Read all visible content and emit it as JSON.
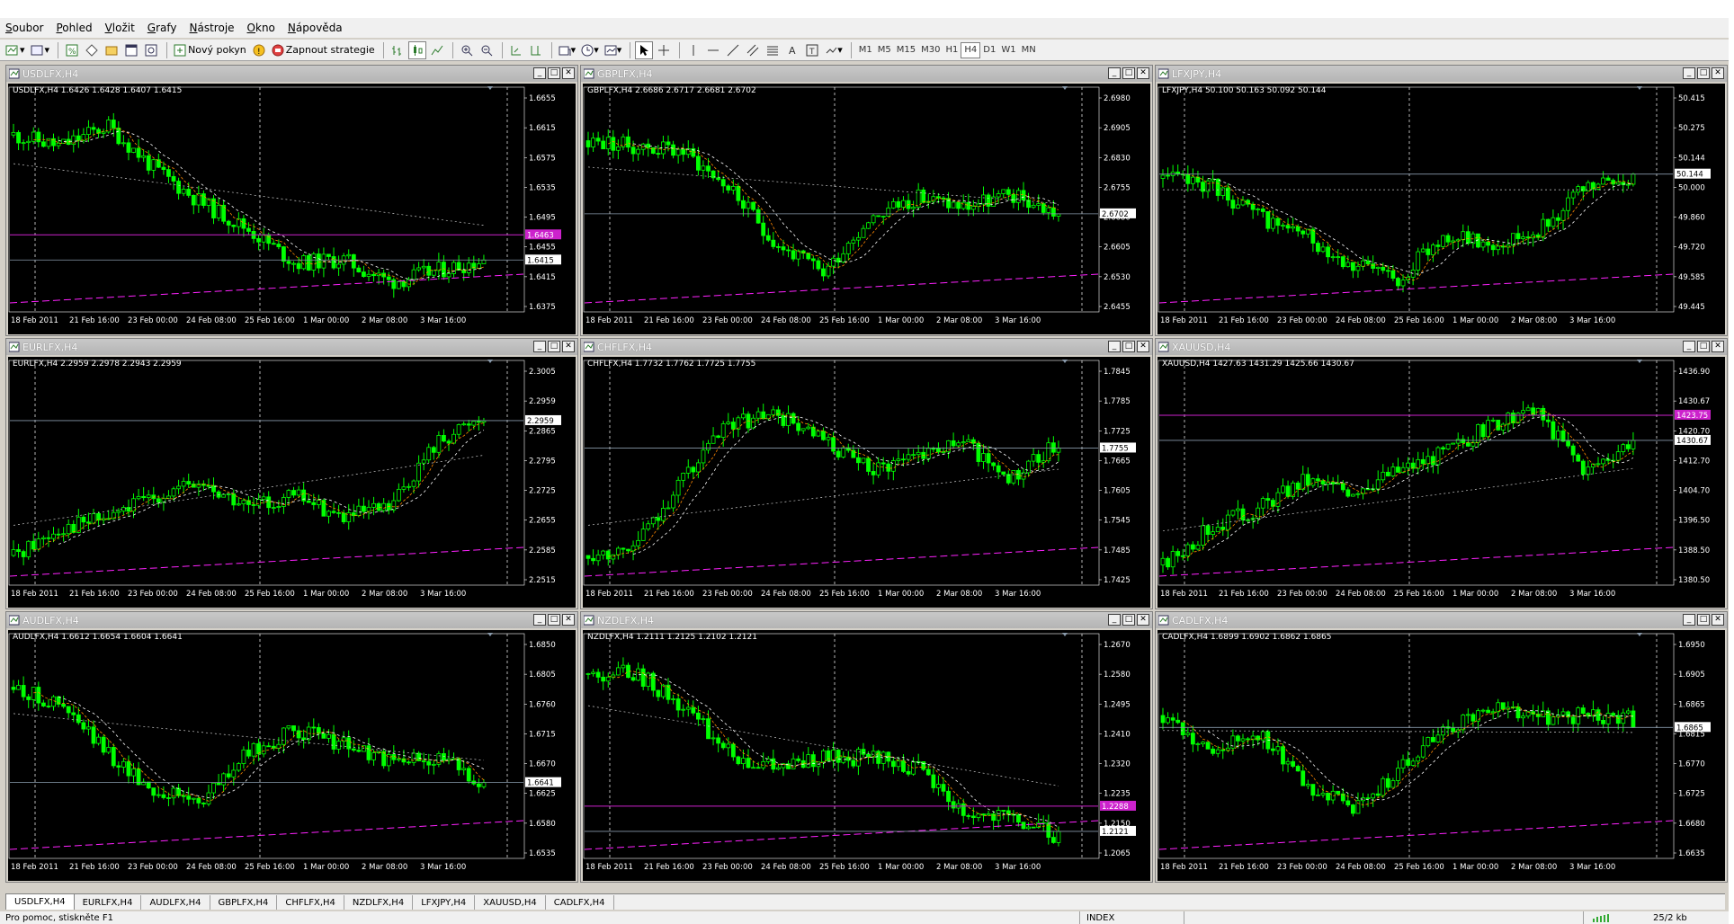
{
  "menu": [
    "Soubor",
    "Pohled",
    "Vložit",
    "Grafy",
    "Nástroje",
    "Okno",
    "Nápověda"
  ],
  "toolbar": {
    "new_order_label": "Nový pokyn",
    "strategy_label": "Zapnout strategie",
    "timeframes": [
      "M1",
      "M5",
      "M15",
      "M30",
      "H1",
      "H4",
      "D1",
      "W1",
      "MN"
    ],
    "active_timeframe": "H4"
  },
  "charts": [
    {
      "title": "USDLFX,H4",
      "ohlc": "USDLFX,H4  1.6426 1.6428 1.6407 1.6415",
      "prices": [
        "1.6655",
        "1.6615",
        "1.6575",
        "1.6535",
        "1.6495",
        "1.6455",
        "1.6415",
        "1.6375"
      ],
      "x_labels": [
        "18 Feb 2011",
        "21 Feb 16:00",
        "23 Feb 00:00",
        "24 Feb 08:00",
        "25 Feb 16:00",
        "1 Mar 00:00",
        "2 Mar 08:00",
        "3 Mar 16:00"
      ],
      "current_price": "1.6415",
      "marked_price": "1.6463",
      "marked_color": "#cc22cc",
      "seed": 11,
      "path": [
        0.88,
        0.82,
        0.93,
        0.7,
        0.52,
        0.38,
        0.2,
        0.22,
        0.1,
        0.16,
        0.22
      ]
    },
    {
      "title": "GBPLFX,H4",
      "ohlc": "GBPLFX,H4  2.6686 2.6717 2.6681 2.6702",
      "prices": [
        "2.6980",
        "2.6905",
        "2.6830",
        "2.6755",
        "2.6680",
        "2.6605",
        "2.6530",
        "2.6455"
      ],
      "x_labels": [
        "18 Feb 2011",
        "21 Feb 16:00",
        "23 Feb 00:00",
        "24 Feb 08:00",
        "25 Feb 16:00",
        "1 Mar 00:00",
        "2 Mar 08:00",
        "3 Mar 16:00"
      ],
      "current_price": "2.6702",
      "marked_price": "",
      "marked_color": "",
      "seed": 23,
      "path": [
        0.85,
        0.82,
        0.8,
        0.6,
        0.3,
        0.15,
        0.45,
        0.55,
        0.5,
        0.56,
        0.46
      ]
    },
    {
      "title": "LFXJPY,H4",
      "ohlc": "LFXJPY,H4  50.100 50.163 50.092 50.144",
      "prices": [
        "50.415",
        "50.275",
        "50.144",
        "50.000",
        "49.860",
        "49.720",
        "49.585",
        "49.445"
      ],
      "x_labels": [
        "18 Feb 2011",
        "21 Feb 16:00",
        "23 Feb 00:00",
        "24 Feb 08:00",
        "25 Feb 16:00",
        "1 Mar 00:00",
        "2 Mar 08:00",
        "3 Mar 16:00"
      ],
      "current_price": "50.144",
      "marked_price": "",
      "marked_color": "",
      "seed": 37,
      "path": [
        0.65,
        0.62,
        0.45,
        0.35,
        0.2,
        0.12,
        0.35,
        0.3,
        0.38,
        0.6,
        0.65
      ]
    },
    {
      "title": "EURLFX,H4",
      "ohlc": "EURLFX,H4  2.2959 2.2978 2.2943 2.2959",
      "prices": [
        "2.3005",
        "2.2959",
        "2.2865",
        "2.2795",
        "2.2725",
        "2.2655",
        "2.2585",
        "2.2515"
      ],
      "x_labels": [
        "18 Feb 2011",
        "21 Feb 16:00",
        "23 Feb 00:00",
        "24 Feb 08:00",
        "25 Feb 16:00",
        "1 Mar 00:00",
        "2 Mar 08:00",
        "3 Mar 16:00"
      ],
      "current_price": "2.2959",
      "marked_price": "",
      "marked_color": "",
      "seed": 41,
      "path": [
        0.1,
        0.25,
        0.3,
        0.42,
        0.48,
        0.35,
        0.42,
        0.3,
        0.35,
        0.7,
        0.85
      ]
    },
    {
      "title": "CHFLFX,H4",
      "ohlc": "CHFLFX,H4  1.7732 1.7762 1.7725 1.7755",
      "prices": [
        "1.7845",
        "1.7785",
        "1.7725",
        "1.7665",
        "1.7605",
        "1.7545",
        "1.7485",
        "1.7425"
      ],
      "x_labels": [
        "18 Feb 2011",
        "21 Feb 16:00",
        "23 Feb 00:00",
        "24 Feb 08:00",
        "25 Feb 16:00",
        "1 Mar 00:00",
        "2 Mar 08:00",
        "3 Mar 16:00"
      ],
      "current_price": "1.7755",
      "marked_price": "",
      "marked_color": "",
      "seed": 53,
      "path": [
        0.1,
        0.15,
        0.5,
        0.8,
        0.85,
        0.7,
        0.55,
        0.65,
        0.7,
        0.5,
        0.7
      ]
    },
    {
      "title": "XAUUSD,H4",
      "ohlc": "XAUUSD,H4  1427.63 1431.29 1425.66 1430.67",
      "prices": [
        "1436.90",
        "1430.67",
        "1420.70",
        "1412.70",
        "1404.70",
        "1396.50",
        "1388.50",
        "1380.50"
      ],
      "x_labels": [
        "18 Feb 2011",
        "21 Feb 16:00",
        "23 Feb 00:00",
        "24 Feb 08:00",
        "25 Feb 16:00",
        "1 Mar 00:00",
        "2 Mar 08:00",
        "3 Mar 16:00"
      ],
      "current_price": "1430.67",
      "marked_price": "1423.75",
      "marked_color": "#cc22cc",
      "seed": 67,
      "path": [
        0.05,
        0.25,
        0.35,
        0.5,
        0.45,
        0.55,
        0.65,
        0.8,
        0.85,
        0.55,
        0.72
      ]
    },
    {
      "title": "AUDLFX,H4",
      "ohlc": "AUDLFX,H4  1.6612 1.6654 1.6604 1.6641",
      "prices": [
        "1.6850",
        "1.6805",
        "1.6760",
        "1.6715",
        "1.6670",
        "1.6625",
        "1.6580",
        "1.6535"
      ],
      "x_labels": [
        "18 Feb 2011",
        "21 Feb 16:00",
        "23 Feb 00:00",
        "24 Feb 08:00",
        "25 Feb 16:00",
        "1 Mar 00:00",
        "2 Mar 08:00",
        "3 Mar 16:00"
      ],
      "current_price": "1.6641",
      "marked_price": "",
      "marked_color": "",
      "seed": 79,
      "path": [
        0.85,
        0.75,
        0.5,
        0.3,
        0.25,
        0.5,
        0.62,
        0.55,
        0.45,
        0.48,
        0.35
      ]
    },
    {
      "title": "NZDLFX,H4",
      "ohlc": "NZDLFX,H4  1.2111 1.2125 1.2102 1.2121",
      "prices": [
        "1.2670",
        "1.2580",
        "1.2495",
        "1.2410",
        "1.2320",
        "1.2235",
        "1.2150",
        "1.2065"
      ],
      "x_labels": [
        "18 Feb 2011",
        "21 Feb 16:00",
        "23 Feb 00:00",
        "24 Feb 08:00",
        "25 Feb 16:00",
        "1 Mar 00:00",
        "2 Mar 08:00",
        "3 Mar 16:00"
      ],
      "current_price": "1.2121",
      "marked_price": "1.2288",
      "marked_color": "#cc22cc",
      "seed": 83,
      "path": [
        0.92,
        0.93,
        0.75,
        0.5,
        0.42,
        0.47,
        0.48,
        0.42,
        0.18,
        0.15,
        0.06
      ]
    },
    {
      "title": "CADLFX,H4",
      "ohlc": "CADLFX,H4  1.6899 1.6902 1.6862 1.6865",
      "prices": [
        "1.6950",
        "1.6905",
        "1.6865",
        "1.6815",
        "1.6770",
        "1.6725",
        "1.6680",
        "1.6635"
      ],
      "x_labels": [
        "18 Feb 2011",
        "21 Feb 16:00",
        "23 Feb 00:00",
        "24 Feb 08:00",
        "25 Feb 16:00",
        "1 Mar 00:00",
        "2 Mar 08:00",
        "3 Mar 16:00"
      ],
      "current_price": "1.6865",
      "marked_price": "",
      "marked_color": "",
      "seed": 97,
      "path": [
        0.7,
        0.5,
        0.62,
        0.35,
        0.2,
        0.4,
        0.62,
        0.75,
        0.68,
        0.7,
        0.68
      ]
    }
  ],
  "tabs": [
    "USDLFX,H4",
    "EURLFX,H4",
    "AUDLFX,H4",
    "GBPLFX,H4",
    "CHFLFX,H4",
    "NZDLFX,H4",
    "LFXJPY,H4",
    "XAUUSD,H4",
    "CADLFX,H4"
  ],
  "active_tab": "USDLFX,H4",
  "status": {
    "help": "Pro pomoc, stiskněte F1",
    "profile": "INDEX",
    "traffic": "25/2 kb"
  },
  "colors": {
    "bull": "#00ff00",
    "bear": "#000000",
    "ma_fast": "#ff8800",
    "ma_slow": "#ffffff",
    "trendline": "#ff22ff",
    "grid": "#ffffff"
  }
}
